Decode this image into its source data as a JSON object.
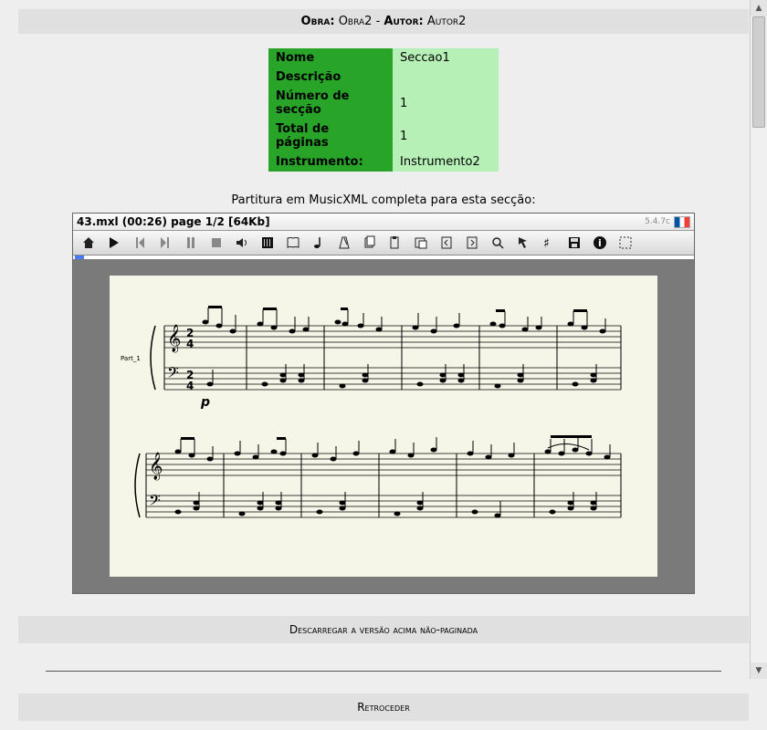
{
  "header": {
    "label_obra": "Obra:",
    "obra": "Obra2",
    "sep": "-",
    "label_autor": "Autor:",
    "autor": "Autor2"
  },
  "info": {
    "rows": [
      {
        "k": "Nome",
        "v": "Seccao1"
      },
      {
        "k": "Descrição",
        "v": ""
      },
      {
        "k": "Número de secção",
        "v": "1"
      },
      {
        "k": "Total de páginas",
        "v": "1"
      },
      {
        "k": "Instrumento:",
        "v": "Instrumento2"
      }
    ]
  },
  "caption": "Partitura em MusicXML completa para esta secção:",
  "viewer": {
    "title": "43.mxl (00:26) page 1/2 [64Kb]",
    "version": "5.4.7c",
    "part_label": "Part_1",
    "dynamic": "p",
    "time_sig": "2/4"
  },
  "download_label": "Descarregar a versão acima não-paginada",
  "back_label": "Retroceder",
  "icons": {
    "home": "home-icon",
    "play": "play-icon",
    "step_back": "step-back-icon",
    "step_fwd": "step-forward-icon",
    "pause": "pause-icon",
    "stop": "stop-icon",
    "volume": "volume-icon",
    "mixer": "mixer-icon",
    "book": "book-icon",
    "note": "note-icon",
    "metronome": "metronome-icon",
    "copy": "copy-icon",
    "paste": "paste-icon",
    "clip": "clip-icon",
    "pageprev": "page-prev-icon",
    "pagenext": "page-next-icon",
    "zoom": "zoom-icon",
    "arrow": "arrow-icon",
    "sharp": "sharp-icon",
    "save": "save-icon",
    "info": "info-icon",
    "full": "fullscreen-icon"
  }
}
